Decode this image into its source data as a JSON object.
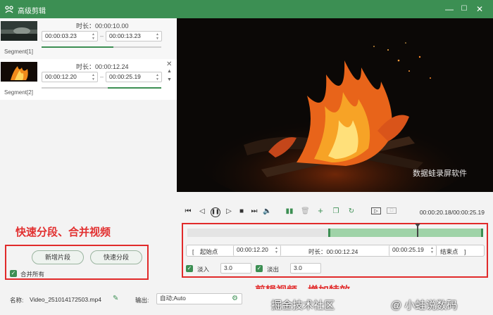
{
  "window": {
    "title": "高级剪辑",
    "min": "—",
    "max": "☐",
    "close": "✕"
  },
  "segments": [
    {
      "label": "Segment[1]",
      "duration_label": "时长：00:00:10.00",
      "start": "00:00:03.23",
      "end": "00:00:13.23",
      "dash": "–"
    },
    {
      "label": "Segment[2]",
      "duration_label": "时长：00:00:12.24",
      "start": "00:00:12.20",
      "end": "00:00:25.19",
      "dash": "–"
    }
  ],
  "left_actions": {
    "add_segment": "新增片段",
    "quick_split": "快速分段",
    "merge_all": "合并所有",
    "annotation": "快速分段、合并视频"
  },
  "player": {
    "watermark": "数据蛙录屏软件",
    "time_readout": "00:00:20.18/00:00:25.19"
  },
  "trim": {
    "start_btn": "[　起始点",
    "start_value": "00:00:12.20",
    "duration_label": "时长：00:00:12.24",
    "end_value": "00:00:25.19",
    "end_btn": "结束点　]",
    "fade_in_label": "淡入",
    "fade_in_value": "3.0",
    "fade_out_label": "淡出",
    "fade_out_value": "3.0",
    "annotation": "剪辑视频，增加特效"
  },
  "footer": {
    "name_label": "名称:",
    "name_value": "Video_251014172503.mp4",
    "output_label": "输出:",
    "output_value": "自动;Auto",
    "overlay_left": "掘金技术社区",
    "overlay_right": "@ 小蛙说数码"
  },
  "colors": {
    "accent": "#3c8f53",
    "annotation": "#e12a2a"
  }
}
